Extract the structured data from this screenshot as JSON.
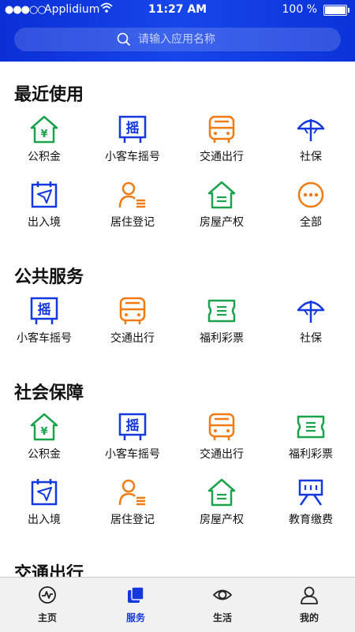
{
  "status_bar": {
    "carrier": "Applidium",
    "time": "11:27 AM",
    "battery": "100 %"
  },
  "search": {
    "placeholder": "请输入应用名称"
  },
  "sections": [
    {
      "title": "最近使用",
      "items": [
        "公积金",
        "小客车摇号",
        "交通出行",
        "社保",
        "出入境",
        "居住登记",
        "房屋产权",
        "全部"
      ]
    },
    {
      "title": "公共服务",
      "items": [
        "小客车摇号",
        "交通出行",
        "福利彩票",
        "社保"
      ]
    },
    {
      "title": "社会保障",
      "items": [
        "公积金",
        "小客车摇号",
        "交通出行",
        "福利彩票",
        "出入境",
        "居住登记",
        "房屋产权",
        "教育缴费"
      ]
    },
    {
      "title": "交通出行"
    }
  ],
  "icon_glyphs": {
    "yao": "摇",
    "yuan": "¥"
  },
  "tabs": [
    {
      "label": "主页",
      "icon": "home-pulse-icon"
    },
    {
      "label": "服务",
      "icon": "service-icon"
    },
    {
      "label": "生活",
      "icon": "life-eye-icon"
    },
    {
      "label": "我的",
      "icon": "profile-icon"
    }
  ],
  "colors": {
    "header": "#1338e0",
    "green": "#1aa34a",
    "blue": "#1338e0",
    "orange": "#f07a14",
    "tab_active": "#1338e0"
  }
}
